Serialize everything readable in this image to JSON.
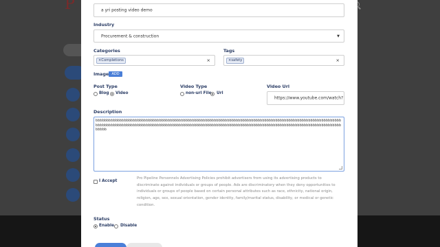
{
  "form": {
    "title_value": "a yri posting video demo",
    "industry_label": "Industry",
    "industry_value": "Procurement & construction",
    "categories_label": "Categories",
    "categories_chip": "Completions",
    "tags_label": "Tags",
    "tags_chip": "safety",
    "image_label": "Image",
    "image_add": "ADD",
    "post_type_label": "Post Type",
    "post_type_options": [
      "Blog",
      "Video"
    ],
    "post_type_selected": "Video",
    "video_type_label": "Video Type",
    "video_type_options": [
      "non-url File",
      "Url"
    ],
    "video_type_selected": "Url",
    "video_url_label": "Video Url",
    "video_url_value": "https://www.youtube.com/watch?",
    "description_label": "Description",
    "description_value": "bbbbbbbbbbbbbbbbbbbbbbbbbbbbbbbbbbbbbbbbbbbbbbbbbbbbbbbbbbbbbbbbbbbbbbbbbbbbbbbbbbbbbbbbbbbbbbbbbbbbbbbbbbbbbbbbbbbbbbbbbbbbbbbbbbbbbbbbbbbbbbbbbbbbbbbbbbbbbbbbbbbbbbbbbbbbbbbbbbbbbbbbbbbbbbbbbbbbbbbbbbbbbbbbbbbbbbbbbbbbbbbbbbbbb",
    "accept_label": "I Accept",
    "policy_text": "Pro Pipeline Personnels Advertising Policies prohibit advertisers from using its advertising products to discriminate against individuals or groups of people. Ads are discriminatory when they deny opportunities to individuals or groups of people based on certain personal attributes such as race, ethnicity, national origin, religion, age, sex, sexual orientation, gender identity, family/marital status, disability, or medical or genetic condition.",
    "status_label": "Status",
    "status_options": [
      "Enable",
      "Disable"
    ],
    "status_selected": "Enable"
  },
  "icons": {
    "select_caret": "▼",
    "clear": "×"
  }
}
